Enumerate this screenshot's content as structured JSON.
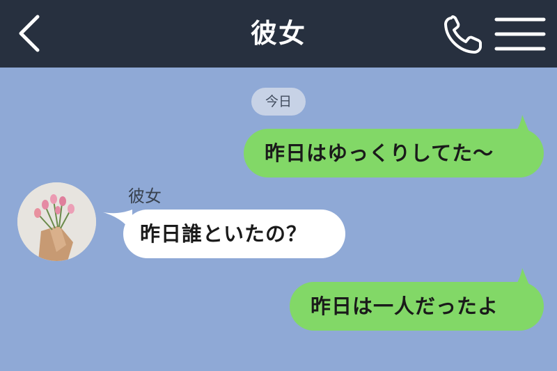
{
  "header": {
    "title": "彼女",
    "back_icon": "chevron-left-icon",
    "call_icon": "phone-icon",
    "menu_icon": "hamburger-menu-icon"
  },
  "chat": {
    "date_label": "今日",
    "messages": [
      {
        "side": "sent",
        "text": "昨日はゆっくりしてた〜"
      },
      {
        "side": "received",
        "sender": "彼女",
        "text": "昨日誰といたの？"
      },
      {
        "side": "sent",
        "text": "昨日は一人だったよ"
      }
    ]
  },
  "colors": {
    "header_bg": "#27303f",
    "chat_bg": "#8fa9d6",
    "sent_bubble": "#82d867",
    "received_bubble": "#ffffff",
    "date_chip": "#c7d2e6"
  }
}
